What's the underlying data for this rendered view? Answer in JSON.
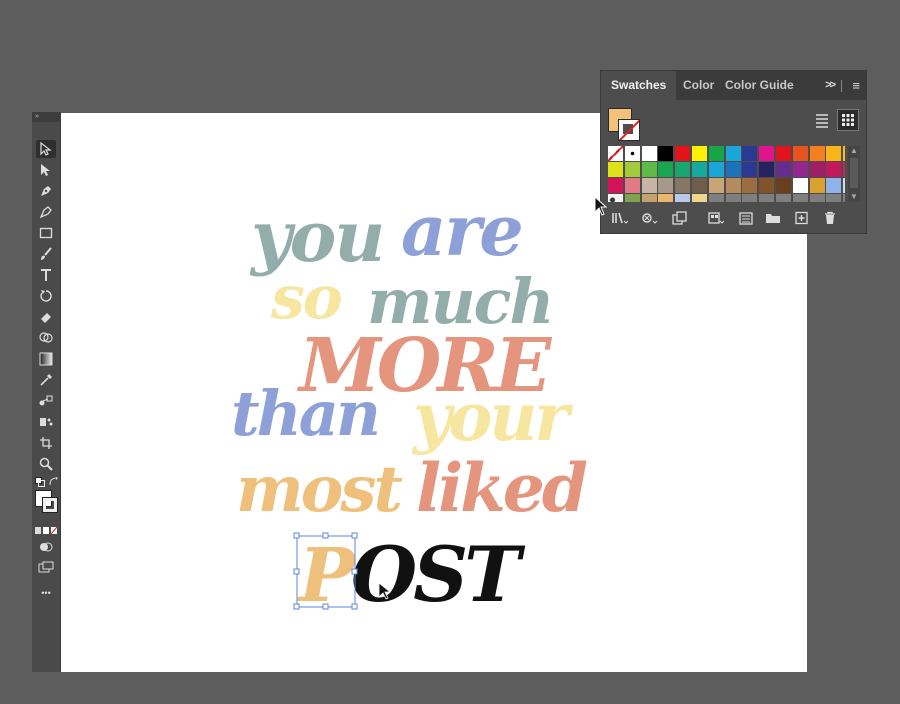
{
  "artwork": {
    "lines": [
      "you are",
      "so much",
      "MORE",
      "than your",
      "most liked",
      "POST"
    ],
    "colors": {
      "sage": "#93aeaa",
      "blue": "#8ea0d8",
      "coral": "#e5957d",
      "butter": "#f6e6a0",
      "orange": "#efc07b",
      "black": "#111111",
      "selection": "#5b86dd"
    }
  },
  "swatches_panel": {
    "tabs": [
      "Swatches",
      "Color",
      "Color Guide"
    ],
    "collapse_label": ">>",
    "menu_label": "≡",
    "current_fill": "#f2c27a",
    "swatch_rows": [
      [
        "none",
        "registration",
        "#ffffff",
        "#000000",
        "#e2141b",
        "#fff200",
        "#18a54a",
        "#1aa6d9",
        "#2b3990",
        "#e3148b",
        "#e2141b",
        "#e85420",
        "#f4801f",
        "#f7b519",
        "#f7c11a"
      ],
      [
        "#dde11a",
        "#a4cb39",
        "#5fbb46",
        "#19a651",
        "#19a570",
        "#16a99e",
        "#1aa6d9",
        "#1b74ba",
        "#2b3990",
        "#262262",
        "#652d90",
        "#92278f",
        "#9e1f63",
        "#c1185f",
        "#d71e5b"
      ],
      [
        "#d4145a",
        "#e07a86",
        "#c6b5a4",
        "#a6988a",
        "#877566",
        "#6e5c4c",
        "#c9a574",
        "#b38b5d",
        "#9b6e40",
        "#81532a",
        "#6b3f1d",
        "#ffffff",
        "#d8a130",
        "#8fb2ea",
        "#c9ddf0"
      ],
      [
        "pattern",
        "#7ea24e",
        "#c5a36c",
        "#e9b86e",
        "#b9c7e8",
        "#f0d58a",
        "#7f7f7f",
        "#7f7f7f",
        "#7f7f7f",
        "#7f7f7f",
        "#7f7f7f",
        "#7f7f7f",
        "#7f7f7f",
        "#7f7f7f",
        "#7f7f7f"
      ]
    ],
    "bottom_buttons": [
      "swatch-libraries-icon",
      "show-kinds-icon",
      "swatch-options-icon",
      "color-group-icon",
      "edit-color-group-icon",
      "new-group-icon",
      "new-swatch-icon",
      "delete-swatch-icon"
    ]
  },
  "toolbar": {
    "grip_label": "»",
    "more_label": "•••",
    "tools": [
      "selection-tool-icon",
      "direct-selection-tool-icon",
      "pen-tool-icon",
      "curvature-tool-icon",
      "rectangle-tool-icon",
      "paintbrush-tool-icon",
      "type-tool-icon",
      "rotate-tool-icon",
      "eraser-tool-icon",
      "shape-builder-tool-icon",
      "gradient-tool-icon",
      "eyedropper-tool-icon",
      "blend-tool-icon",
      "symbol-sprayer-tool-icon",
      "artboard-tool-icon",
      "zoom-tool-icon"
    ]
  }
}
